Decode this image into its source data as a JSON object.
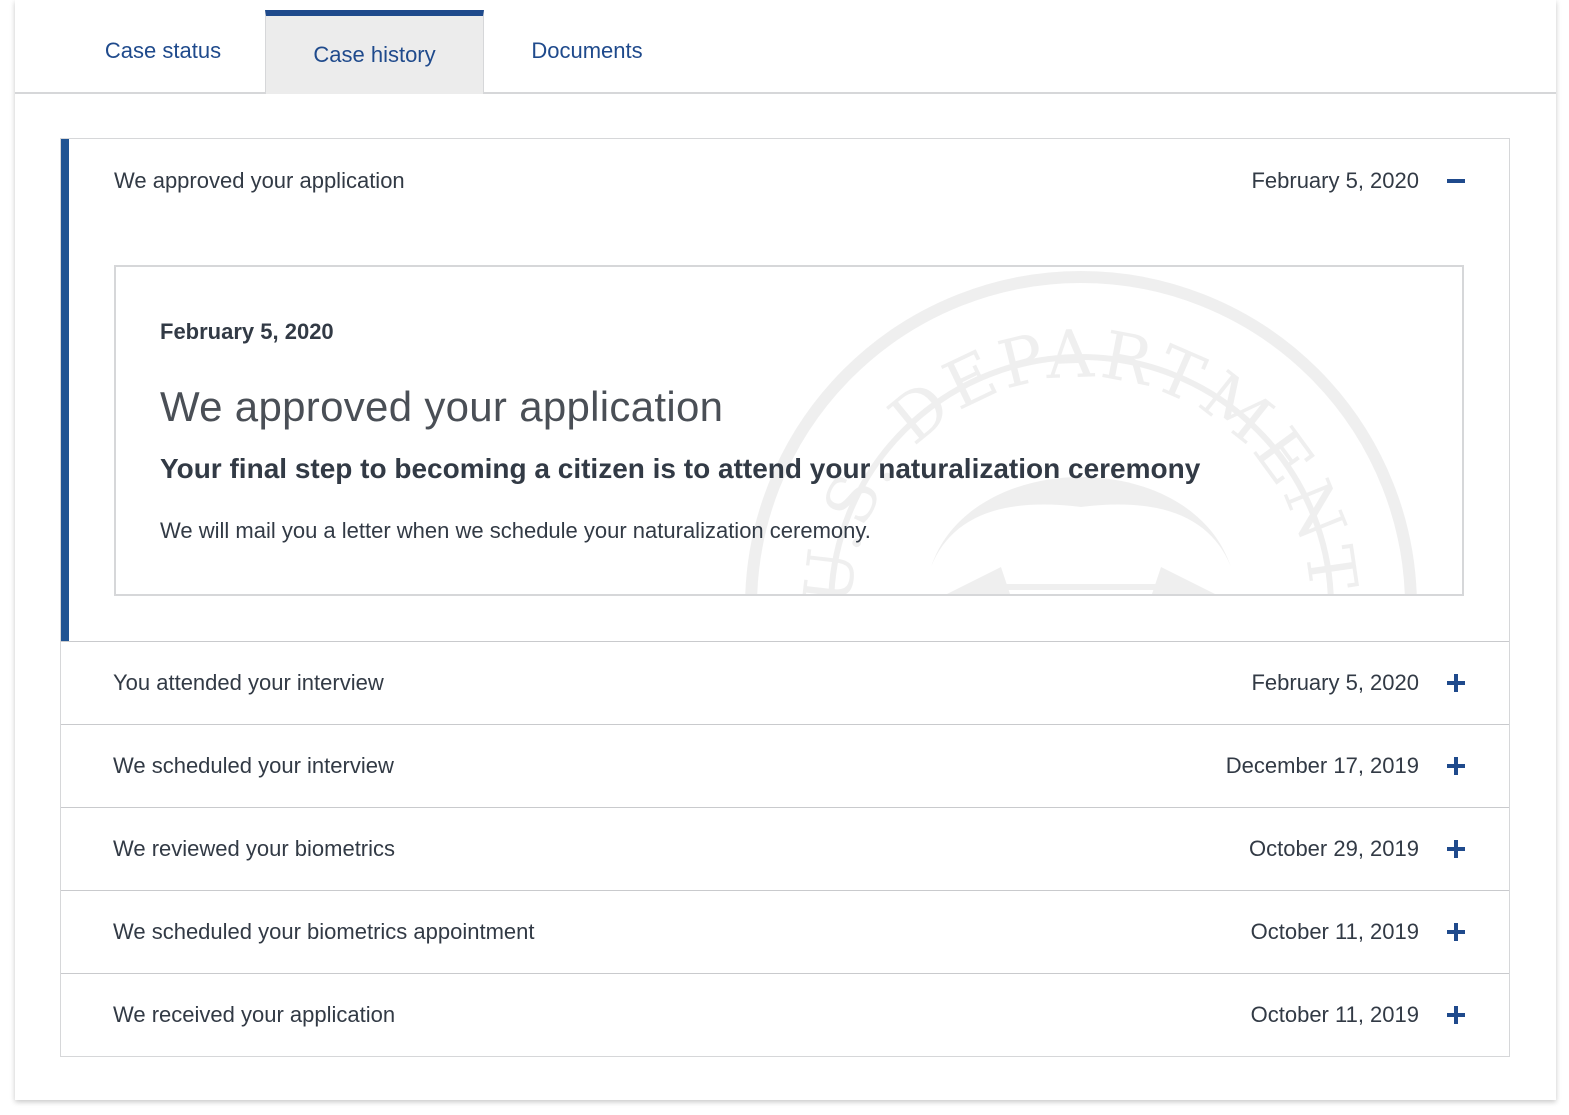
{
  "tabs": [
    {
      "label": "Case status",
      "active": false
    },
    {
      "label": "Case history",
      "active": true
    },
    {
      "label": "Documents",
      "active": false
    }
  ],
  "history": [
    {
      "title": "We approved your application",
      "date": "February 5, 2020",
      "expanded": true,
      "toggle_icon": "minus-icon",
      "detail": {
        "date": "February 5, 2020",
        "title": "We approved your application",
        "subtitle": "Your final step to becoming a citizen is to attend your naturalization ceremony",
        "text": "We will mail you a letter when we schedule your naturalization ceremony.",
        "watermark_text": "U.S. DEPARTMENT OF"
      }
    },
    {
      "title": "You attended your interview",
      "date": "February 5, 2020",
      "expanded": false,
      "toggle_icon": "plus-icon"
    },
    {
      "title": "We scheduled your interview",
      "date": "December 17, 2019",
      "expanded": false,
      "toggle_icon": "plus-icon"
    },
    {
      "title": "We reviewed your biometrics",
      "date": "October 29, 2019",
      "expanded": false,
      "toggle_icon": "plus-icon"
    },
    {
      "title": "We scheduled your biometrics appointment",
      "date": "October 11, 2019",
      "expanded": false,
      "toggle_icon": "plus-icon"
    },
    {
      "title": "We received your application",
      "date": "October 11, 2019",
      "expanded": false,
      "toggle_icon": "plus-icon"
    }
  ],
  "colors": {
    "accent": "#1f4a8c",
    "expanded_border": "#205493",
    "active_tab_bg": "#ececec",
    "text": "#323a45",
    "border": "#d6d7d9"
  }
}
